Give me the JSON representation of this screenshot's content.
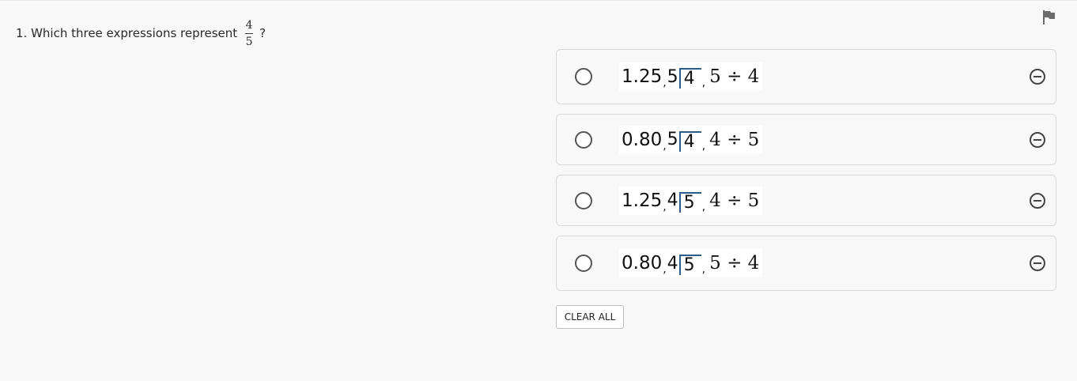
{
  "question": {
    "number_text": "1. Which three expressions represent",
    "fraction": {
      "numerator": "4",
      "denominator": "5"
    },
    "question_mark": "?"
  },
  "flag": {
    "icon": "flag-icon"
  },
  "options": [
    {
      "decimal": "1.25",
      "sep1": ",",
      "divisor": "5",
      "dividend": "4",
      "sep2": ",",
      "division": "5 ÷ 4",
      "selected": false
    },
    {
      "decimal": "0.80",
      "sep1": ",",
      "divisor": "5",
      "dividend": "4",
      "sep2": ",",
      "division": "4 ÷ 5",
      "selected": false
    },
    {
      "decimal": "1.25",
      "sep1": ",",
      "divisor": "4",
      "dividend": "5",
      "sep2": ",",
      "division": "4 ÷ 5",
      "selected": false
    },
    {
      "decimal": "0.80",
      "sep1": ",",
      "divisor": "4",
      "dividend": "5",
      "sep2": ",",
      "division": "5 ÷ 4",
      "selected": false
    }
  ],
  "clear_all": {
    "label": "CLEAR ALL"
  },
  "colors": {
    "background": "#f8f8f8",
    "border": "#d8d8d8",
    "long_division_bracket": "#2a5d8a"
  }
}
